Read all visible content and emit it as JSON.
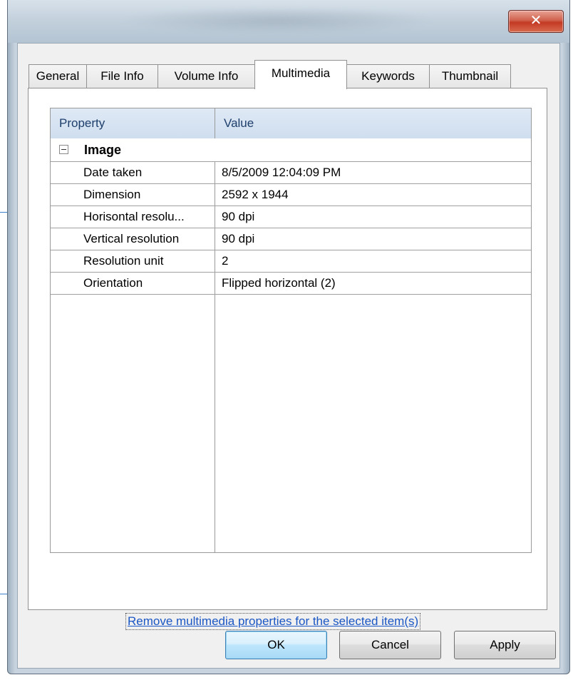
{
  "window": {
    "close_glyph": "✕",
    "close_icon": "close-icon"
  },
  "tabs": [
    {
      "label": "General",
      "active": false
    },
    {
      "label": "File Info",
      "active": false
    },
    {
      "label": "Volume Info",
      "active": false
    },
    {
      "label": "Multimedia",
      "active": true
    },
    {
      "label": "Keywords",
      "active": false
    },
    {
      "label": "Thumbnail",
      "active": false
    }
  ],
  "grid": {
    "headers": {
      "property": "Property",
      "value": "Value"
    },
    "group": {
      "label": "Image",
      "expanded": true,
      "expander_icon": "collapse-minus-icon"
    },
    "rows": [
      {
        "property": "Date taken",
        "value": "8/5/2009 12:04:09 PM"
      },
      {
        "property": "Dimension",
        "value": "2592 x 1944"
      },
      {
        "property": "Horisontal resolu...",
        "value": "90 dpi"
      },
      {
        "property": "Vertical resolution",
        "value": "90 dpi"
      },
      {
        "property": "Resolution unit",
        "value": "2"
      },
      {
        "property": "Orientation",
        "value": "Flipped horizontal (2)"
      }
    ]
  },
  "link": {
    "remove_label": "Remove multimedia properties for the selected item(s)"
  },
  "buttons": {
    "ok": "OK",
    "cancel": "Cancel",
    "apply": "Apply"
  },
  "colors": {
    "link": "#1a56c4",
    "header_text": "#1e3f6c",
    "close_button": "#c43a24",
    "callout_line": "#3a7fc8"
  }
}
